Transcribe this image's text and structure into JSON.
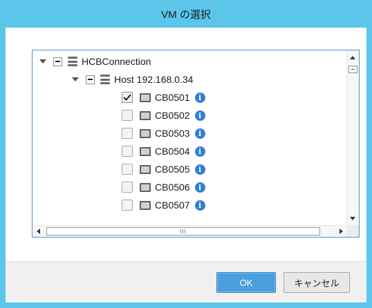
{
  "window": {
    "title": "VM の選択",
    "accent_color": "#5bc6ea"
  },
  "tree": {
    "root": {
      "label": "HCBConnection",
      "expanded": true,
      "state": "partial",
      "icon": "server-group-icon"
    },
    "host": {
      "label": "Host 192.168.0.34",
      "expanded": true,
      "state": "partial",
      "icon": "server-icon"
    },
    "vms": [
      {
        "label": "CB0501",
        "checked": true,
        "icon": "vm-icon",
        "info": "info-icon"
      },
      {
        "label": "CB0502",
        "checked": false,
        "icon": "vm-icon",
        "info": "info-icon"
      },
      {
        "label": "CB0503",
        "checked": false,
        "icon": "vm-icon",
        "info": "info-icon"
      },
      {
        "label": "CB0504",
        "checked": false,
        "icon": "vm-icon",
        "info": "info-icon"
      },
      {
        "label": "CB0505",
        "checked": false,
        "icon": "vm-icon",
        "info": "info-icon"
      },
      {
        "label": "CB0506",
        "checked": false,
        "icon": "vm-icon",
        "info": "info-icon"
      },
      {
        "label": "CB0507",
        "checked": false,
        "icon": "vm-icon",
        "info": "info-icon"
      }
    ],
    "info_glyph": "i",
    "hscroll_grip": "III"
  },
  "buttons": {
    "ok": "OK",
    "cancel": "キャンセル"
  }
}
